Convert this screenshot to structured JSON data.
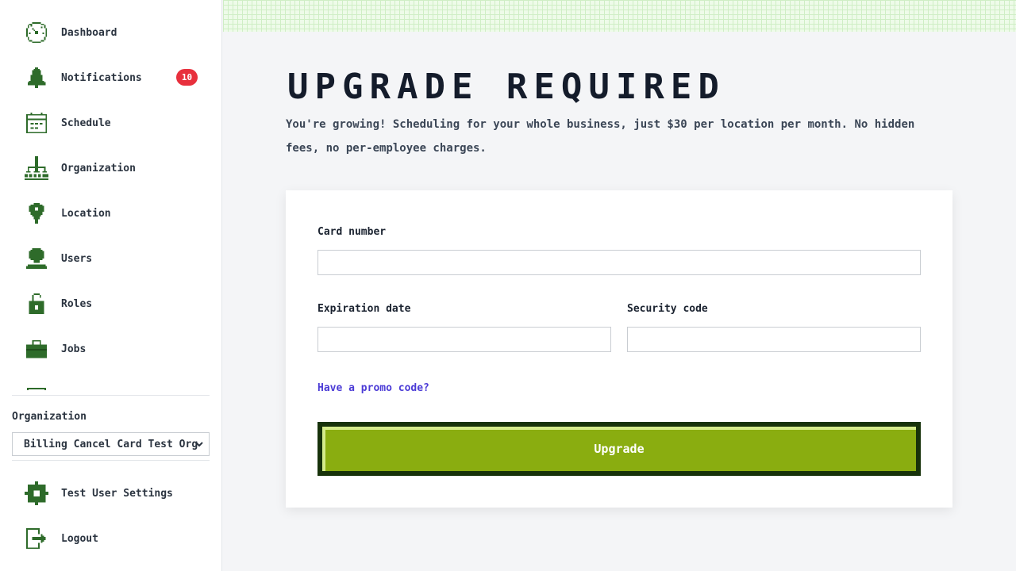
{
  "sidebar": {
    "items": [
      {
        "label": "Dashboard",
        "icon": "dashboard-icon"
      },
      {
        "label": "Notifications",
        "icon": "bell-icon",
        "badge": "10"
      },
      {
        "label": "Schedule",
        "icon": "calendar-icon"
      },
      {
        "label": "Organization",
        "icon": "org-chart-icon"
      },
      {
        "label": "Location",
        "icon": "location-pin-icon"
      },
      {
        "label": "Users",
        "icon": "user-icon"
      },
      {
        "label": "Roles",
        "icon": "unlock-icon"
      },
      {
        "label": "Jobs",
        "icon": "briefcase-icon"
      }
    ],
    "organization_label": "Organization",
    "organization_select": "Billing Cancel Card Test Org",
    "settings_label": "Test User Settings",
    "logout_label": "Logout"
  },
  "main": {
    "title": "Upgrade Required",
    "description": "You're growing! Scheduling for your whole business, just $30 per location per month. No hidden fees, no per-employee charges.",
    "form": {
      "card_number_label": "Card number",
      "card_number_value": "",
      "expiration_label": "Expiration date",
      "expiration_value": "",
      "security_label": "Security code",
      "security_value": "",
      "promo_link": "Have a promo code?",
      "upgrade_button": "Upgrade"
    }
  },
  "colors": {
    "icon_green": "#2e6b2a",
    "button_green": "#8aad10",
    "button_border": "#17320a",
    "badge_red": "#e8303d",
    "link_purple": "#4b3bd6"
  }
}
